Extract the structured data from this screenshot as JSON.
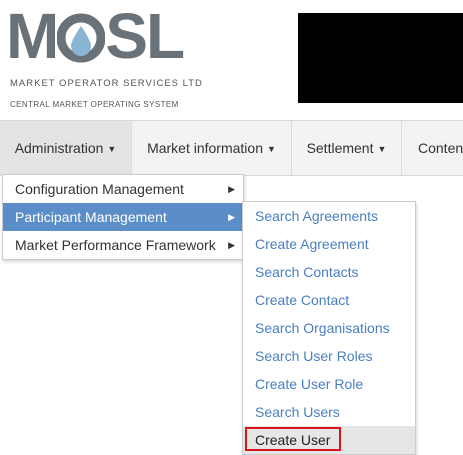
{
  "logo": {
    "word_left": "M",
    "word_right": "SL",
    "line1": "MARKET OPERATOR SERVICES LTD",
    "line2": "CENTRAL MARKET OPERATING SYSTEM"
  },
  "menu": [
    {
      "label": "Administration"
    },
    {
      "label": "Market information"
    },
    {
      "label": "Settlement"
    },
    {
      "label": "Conten"
    }
  ],
  "admin_menu": [
    {
      "label": "Configuration Management"
    },
    {
      "label": "Participant Management"
    },
    {
      "label": "Market Performance Framework"
    }
  ],
  "participant_menu": [
    {
      "label": "Search Agreements"
    },
    {
      "label": "Create Agreement"
    },
    {
      "label": "Search Contacts"
    },
    {
      "label": "Create Contact"
    },
    {
      "label": "Search Organisations"
    },
    {
      "label": "Search User Roles"
    },
    {
      "label": "Create User Role"
    },
    {
      "label": "Search Users"
    },
    {
      "label": "Create User"
    }
  ],
  "colors": {
    "accent": "#5b8ec8",
    "link": "#4a7fbf",
    "highlight": "#d9141c",
    "droplet": "#8ab4d4"
  }
}
